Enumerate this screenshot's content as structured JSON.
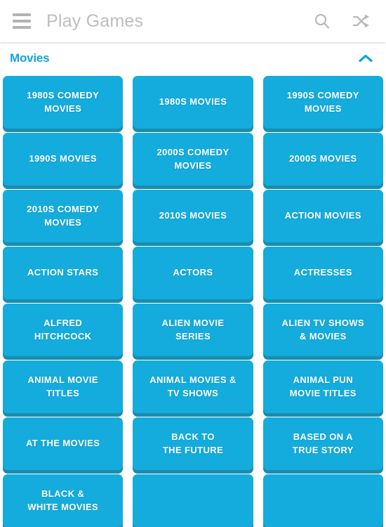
{
  "header": {
    "title": "Play Games",
    "menu_icon": "hamburger-menu-icon",
    "search_icon": "search-icon",
    "shuffle_icon": "shuffle-random-icon"
  },
  "section": {
    "title": "Movies",
    "collapse_icon": "chevron-up-icon",
    "expanded": true
  },
  "colors": {
    "tile_fill": "#14abdd",
    "tile_shadow": "#1b8cad",
    "accent": "#12a5db",
    "header_text": "#bdbdbd",
    "icon_gray": "#b3b3b3",
    "tile_text": "#ffffff",
    "page_background": "#ffffff"
  },
  "tiles": [
    {
      "label": "1980s COMEDY\nMOVIES"
    },
    {
      "label": "1980s MOVIES"
    },
    {
      "label": "1990s COMEDY\nMOVIES"
    },
    {
      "label": "1990s MOVIES"
    },
    {
      "label": "2000s COMEDY\nMOVIES"
    },
    {
      "label": "2000s MOVIES"
    },
    {
      "label": "2010s COMEDY\nMOVIES"
    },
    {
      "label": "2010s MOVIES"
    },
    {
      "label": "ACTION MOVIES"
    },
    {
      "label": "ACTION STARS"
    },
    {
      "label": "ACTORS"
    },
    {
      "label": "ACTRESSES"
    },
    {
      "label": "ALFRED\nHITCHCOCK"
    },
    {
      "label": "ALIEN MOVIE\nSERIES"
    },
    {
      "label": "ALIEN TV SHOWS\n& MOVIES"
    },
    {
      "label": "ANIMAL MOVIE\nTITLES"
    },
    {
      "label": "ANIMAL MOVIES &\nTV SHOWS"
    },
    {
      "label": "ANIMAL PUN\nMOVIE TITLES"
    },
    {
      "label": "AT THE MOVIES"
    },
    {
      "label": "BACK TO\nTHE FUTURE"
    },
    {
      "label": "BASED ON A\nTRUE STORY"
    },
    {
      "label": "BLACK &\nWHITE MOVIES"
    },
    {
      "label": ""
    },
    {
      "label": ""
    }
  ]
}
